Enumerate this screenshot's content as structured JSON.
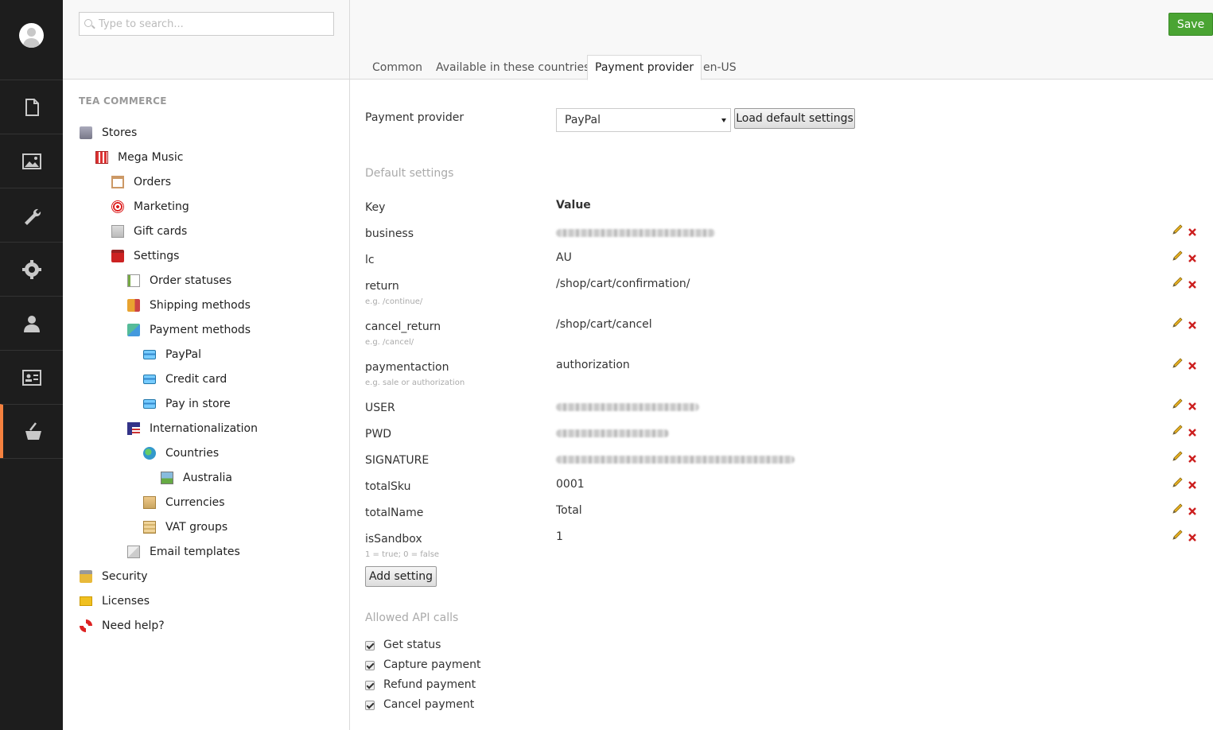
{
  "header": {
    "save_label": "Save"
  },
  "search": {
    "placeholder": "Type to search..."
  },
  "rail": {
    "items": [
      "content-icon",
      "media-icon",
      "developer-icon",
      "settings-icon",
      "users-icon",
      "members-icon",
      "tea-commerce-icon"
    ]
  },
  "tree": {
    "section": "TEA COMMERCE",
    "items": [
      {
        "label": "Stores",
        "icon": "building-icon"
      },
      {
        "label": "Mega Music",
        "icon": "store-icon"
      },
      {
        "label": "Orders",
        "icon": "clipboard-icon"
      },
      {
        "label": "Marketing",
        "icon": "target-icon"
      },
      {
        "label": "Gift cards",
        "icon": "gift-card-icon"
      },
      {
        "label": "Settings",
        "icon": "toolbox-icon"
      },
      {
        "label": "Order statuses",
        "icon": "checklist-icon"
      },
      {
        "label": "Shipping methods",
        "icon": "truck-icon"
      },
      {
        "label": "Payment methods",
        "icon": "payment-methods-icon"
      },
      {
        "label": "PayPal",
        "icon": "card-icon"
      },
      {
        "label": "Credit card",
        "icon": "card-icon"
      },
      {
        "label": "Pay in store",
        "icon": "card-icon"
      },
      {
        "label": "Internationalization",
        "icon": "flag-icon"
      },
      {
        "label": "Countries",
        "icon": "globe-icon"
      },
      {
        "label": "Australia",
        "icon": "picture-icon"
      },
      {
        "label": "Currencies",
        "icon": "currency-icon"
      },
      {
        "label": "VAT groups",
        "icon": "vat-icon"
      },
      {
        "label": "Email templates",
        "icon": "email-template-icon"
      },
      {
        "label": "Security",
        "icon": "lock-icon"
      },
      {
        "label": "Licenses",
        "icon": "license-icon"
      },
      {
        "label": "Need help?",
        "icon": "lifebuoy-icon"
      }
    ]
  },
  "tabs": [
    "Common",
    "Available in these countries",
    "Payment provider",
    "en-US"
  ],
  "active_tab": "Payment provider",
  "provider": {
    "label": "Payment provider",
    "selected": "PayPal",
    "load_button": "Load default settings"
  },
  "defaults": {
    "title": "Default settings",
    "key_header": "Key",
    "value_header": "Value",
    "rows": [
      {
        "key": "business",
        "value": "",
        "hint": ""
      },
      {
        "key": "lc",
        "value": "AU",
        "hint": ""
      },
      {
        "key": "return",
        "value": "/shop/cart/confirmation/",
        "hint": "e.g. /continue/"
      },
      {
        "key": "cancel_return",
        "value": "/shop/cart/cancel",
        "hint": "e.g. /cancel/"
      },
      {
        "key": "paymentaction",
        "value": "authorization",
        "hint": "e.g. sale or authorization"
      },
      {
        "key": "USER",
        "value": "",
        "hint": ""
      },
      {
        "key": "PWD",
        "value": "",
        "hint": ""
      },
      {
        "key": "SIGNATURE",
        "value": "",
        "hint": ""
      },
      {
        "key": "totalSku",
        "value": "0001",
        "hint": ""
      },
      {
        "key": "totalName",
        "value": "Total",
        "hint": ""
      },
      {
        "key": "isSandbox",
        "value": "1",
        "hint": "1 = true; 0 = false"
      }
    ],
    "add_button": "Add setting"
  },
  "api": {
    "title": "Allowed API calls",
    "items": [
      {
        "label": "Get status",
        "checked": true
      },
      {
        "label": "Capture payment",
        "checked": true
      },
      {
        "label": "Refund payment",
        "checked": true
      },
      {
        "label": "Cancel payment",
        "checked": true
      }
    ]
  },
  "colors": {
    "rail_bg": "#1d1d1d",
    "accent": "#f5813f",
    "save_green": "#4aa433",
    "delete_red": "#cc1f1f"
  }
}
